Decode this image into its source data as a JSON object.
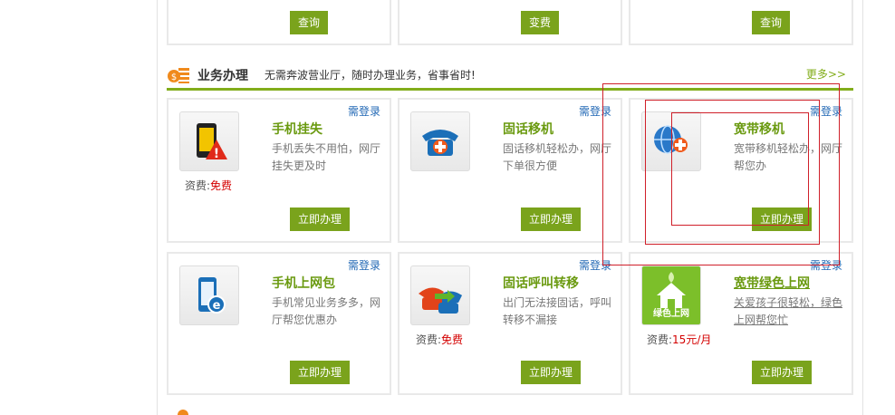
{
  "top_buttons": [
    "查询",
    "变费",
    "查询"
  ],
  "section": {
    "title": "业务办理",
    "subtitle": "无需奔波营业厅，随时办理业务，省事省时!",
    "more": "更多>>"
  },
  "login_label": "需登录",
  "action_label": "立即办理",
  "fee_prefix": "资费:",
  "services": [
    {
      "title": "手机挂失",
      "desc": "手机丢失不用怕，网厅挂失更及时",
      "fee": "免费",
      "icon": "phone-warning-icon"
    },
    {
      "title": "固话移机",
      "desc": "固话移机轻松办，网厅下单很方便",
      "fee": "",
      "icon": "telephone-plus-icon"
    },
    {
      "title": "宽带移机",
      "desc": "宽带移机轻松办，网厅帮您办",
      "fee": "",
      "icon": "globe-plus-icon"
    },
    {
      "title": "手机上网包",
      "desc": "手机常见业务多多，网厅帮您优惠办",
      "fee": "",
      "icon": "phone-internet-icon"
    },
    {
      "title": "固话呼叫转移",
      "desc": "出门无法接固话，呼叫转移不漏接",
      "fee": "免费",
      "icon": "telephone-forward-icon"
    },
    {
      "title": "宽带绿色上网",
      "desc": "关爱孩子很轻松，绿色上网帮您忙",
      "fee": "15元/月",
      "icon": "green-house-icon",
      "icon_text": "绿色上网"
    }
  ],
  "colors": {
    "accent_green": "#82ad1b",
    "button_green": "#7aa31c",
    "login_blue": "#2268b5",
    "fee_red": "#d40000",
    "annotation_red": "#d0202a"
  }
}
